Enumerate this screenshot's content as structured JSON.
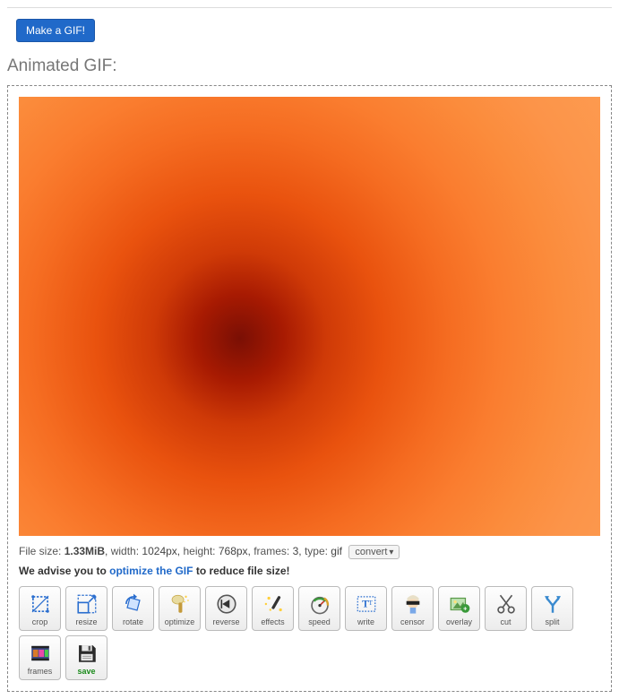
{
  "top_button": "Make a GIF!",
  "section_title": "Animated GIF:",
  "info": {
    "size_label": "File size:",
    "size_value": "1.33MiB",
    "width_label": "width:",
    "width_value": "1024px",
    "height_label": "height:",
    "height_value": "768px",
    "frames_label": "frames:",
    "frames_value": "3",
    "type_label": "type:",
    "type_value": "gif",
    "convert_label": "convert"
  },
  "advise": {
    "prefix": "We advise you to ",
    "link": "optimize the GIF",
    "suffix": " to reduce file size!"
  },
  "tools": [
    {
      "id": "crop",
      "label": "crop"
    },
    {
      "id": "resize",
      "label": "resize"
    },
    {
      "id": "rotate",
      "label": "rotate"
    },
    {
      "id": "optimize",
      "label": "optimize"
    },
    {
      "id": "reverse",
      "label": "reverse"
    },
    {
      "id": "effects",
      "label": "effects"
    },
    {
      "id": "speed",
      "label": "speed"
    },
    {
      "id": "write",
      "label": "write"
    },
    {
      "id": "censor",
      "label": "censor"
    },
    {
      "id": "overlay",
      "label": "overlay"
    },
    {
      "id": "cut",
      "label": "cut"
    },
    {
      "id": "split",
      "label": "split"
    },
    {
      "id": "frames",
      "label": "frames"
    },
    {
      "id": "save",
      "label": "save"
    }
  ]
}
